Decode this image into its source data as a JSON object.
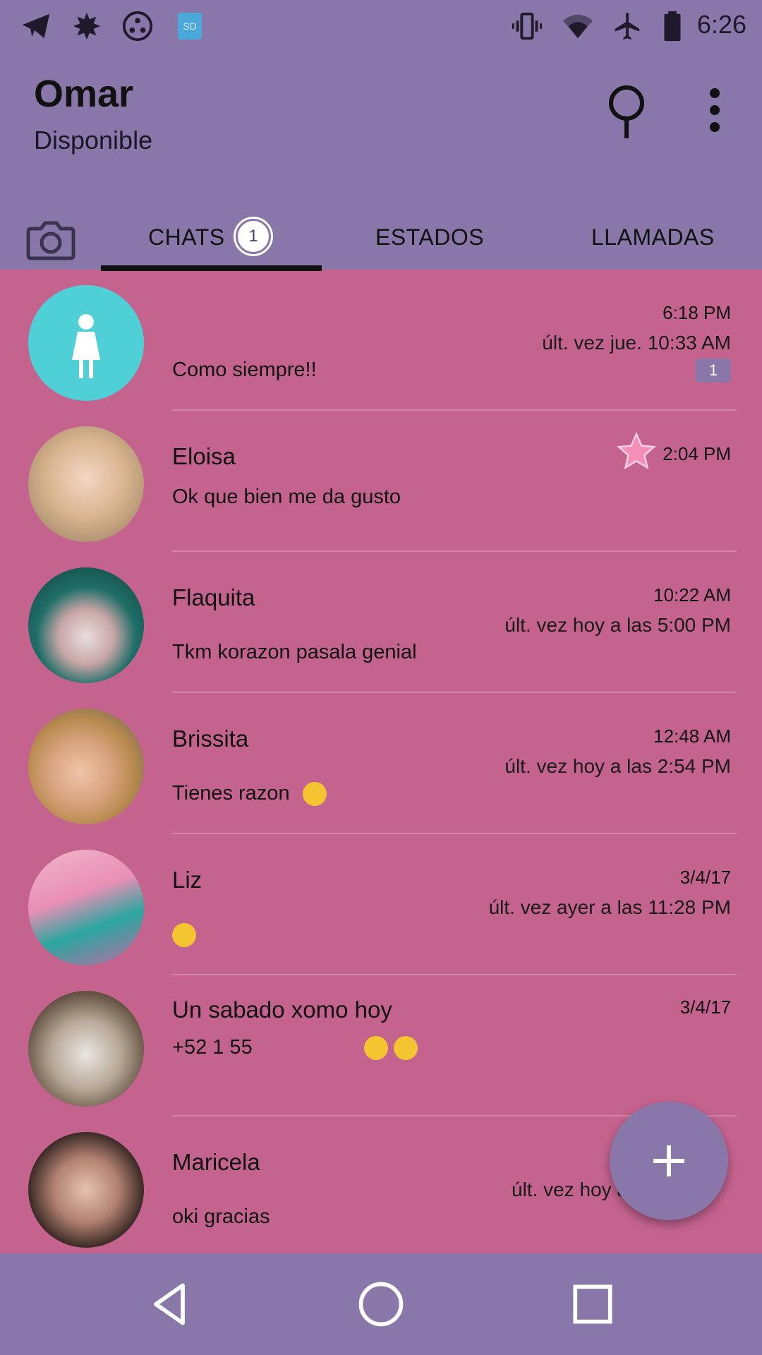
{
  "status_bar": {
    "time": "6:26",
    "left_icons": [
      "telegram-icon",
      "leaf-icon",
      "circles-icon",
      "sd-card-icon"
    ],
    "right_icons": [
      "vibrate-icon",
      "wifi-icon",
      "airplane-icon",
      "battery-icon"
    ],
    "sd_label": "SD"
  },
  "profile": {
    "name": "Omar",
    "status": "Disponible"
  },
  "tabs": {
    "chats": "CHATS",
    "chats_badge": "1",
    "estados": "ESTADOS",
    "llamadas": "LLAMADAS"
  },
  "chats": [
    {
      "name": "",
      "time": "6:18 PM",
      "last_seen": "últ. vez jue. 10:33 AM",
      "message": "Como siempre!!",
      "unread": "1",
      "avatar": "default-female-avatar"
    },
    {
      "name": "Eloisa",
      "time": "2:04 PM",
      "last_seen": "",
      "message": "Ok que bien me da gusto",
      "starred": true
    },
    {
      "name": "Flaquita",
      "time": "10:22 AM",
      "last_seen": "últ. vez hoy a las 5:00 PM",
      "message": "Tkm korazon pasala genial"
    },
    {
      "name": "Brissita",
      "time": "12:48 AM",
      "last_seen": "últ. vez hoy a las 2:54 PM",
      "message": "Tienes razon"
    },
    {
      "name": "Liz",
      "time": "3/4/17",
      "last_seen": "últ. vez ayer a las 11:28 PM",
      "message": ""
    },
    {
      "name": "Un sabado xomo hoy",
      "time": "3/4/17",
      "last_seen": "",
      "message": "+52 1 55"
    },
    {
      "name": "Maricela",
      "time": "",
      "last_seen": "últ. vez hoy a",
      "message": "oki gracias"
    }
  ],
  "colors": {
    "header": "#8877a8",
    "list_background": "#c5638f",
    "unread_badge": "#8877a8",
    "star": "#f48fb8"
  }
}
